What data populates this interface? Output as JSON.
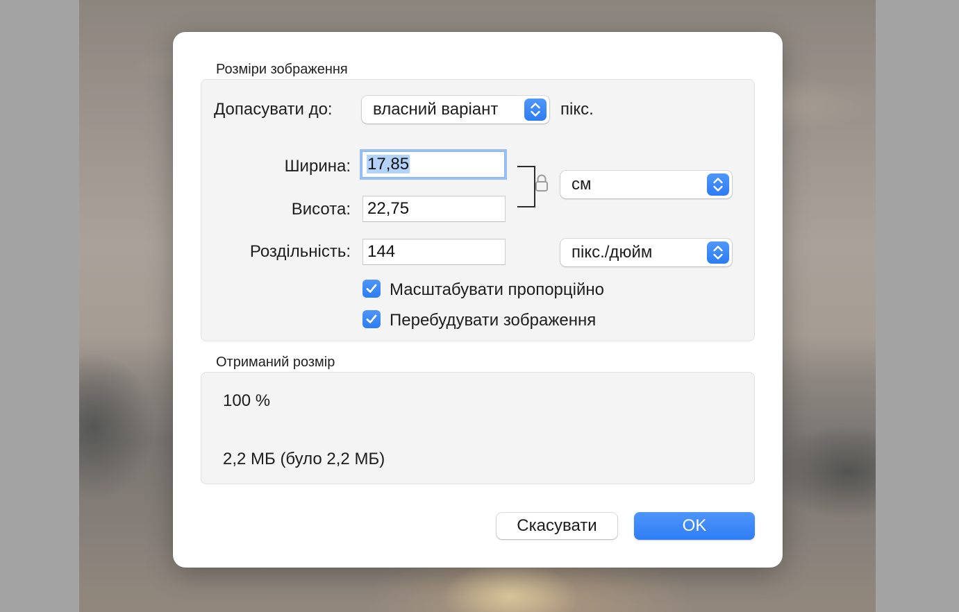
{
  "dialog": {
    "image_dimensions": {
      "section_title": "Розміри зображення",
      "fit_into_label": "Допасувати до:",
      "fit_into_value": "власний варіант",
      "fit_into_unit": "пікс.",
      "width_label": "Ширина:",
      "width_value": "17,85",
      "height_label": "Висота:",
      "height_value": "22,75",
      "resolution_label": "Роздільність:",
      "resolution_value": "144",
      "size_unit_value": "см",
      "resolution_unit_value": "пікс./дюйм",
      "scale_proportionally_label": "Масштабувати пропорційно",
      "scale_proportionally_checked": true,
      "resample_label": "Перебудувати зображення",
      "resample_checked": true
    },
    "resulting_size": {
      "section_title": "Отриманий розмір",
      "percent": "100 %",
      "file_size": "2,2 МБ (було 2,2 МБ)"
    },
    "buttons": {
      "cancel_label": "Скасувати",
      "ok_label": "OK"
    }
  },
  "colors": {
    "accent": "#2c7cf5",
    "focus_ring": "#4f94f6",
    "selection": "#b3d3fb",
    "group_background": "#f4f4f4"
  },
  "icons": {
    "lock": "lock-icon",
    "stepper": "up-down-chevron-icon",
    "checkmark": "checkmark-icon"
  }
}
